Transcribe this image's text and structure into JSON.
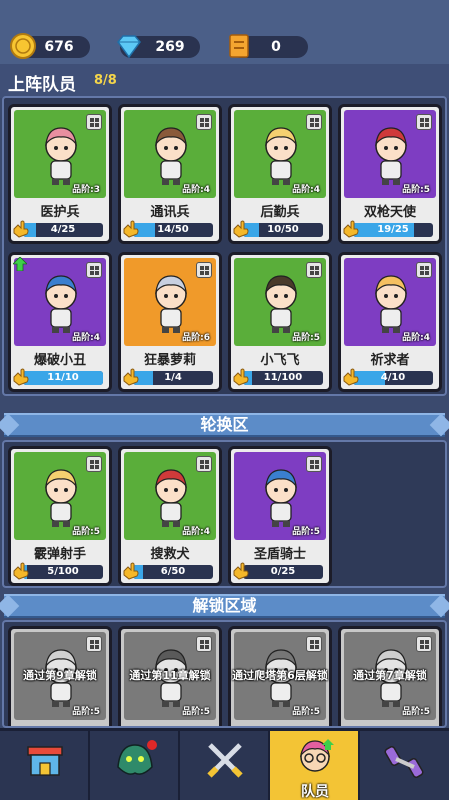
{
  "resources": {
    "coins": "676",
    "gems": "269",
    "tickets": "0"
  },
  "lineup": {
    "title": "上阵队员",
    "count": "8/8",
    "heroes": [
      {
        "name": "医护兵",
        "rank": "品阶:3",
        "progress": "4/25",
        "fill": 0.16,
        "bg": "green"
      },
      {
        "name": "通讯兵",
        "rank": "品阶:4",
        "progress": "14/50",
        "fill": 0.28,
        "bg": "green"
      },
      {
        "name": "后勤兵",
        "rank": "品阶:4",
        "progress": "10/50",
        "fill": 0.2,
        "bg": "green"
      },
      {
        "name": "双枪天使",
        "rank": "品阶:5",
        "progress": "19/25",
        "fill": 0.76,
        "bg": "purple"
      },
      {
        "name": "爆破小丑",
        "rank": "品阶:4",
        "progress": "11/10",
        "fill": 1.0,
        "bg": "purple"
      },
      {
        "name": "狂暴萝莉",
        "rank": "品阶:6",
        "progress": "1/4",
        "fill": 0.25,
        "bg": "orange"
      },
      {
        "name": "小飞飞",
        "rank": "品阶:5",
        "progress": "11/100",
        "fill": 0.11,
        "bg": "green"
      },
      {
        "name": "祈求者",
        "rank": "品阶:4",
        "progress": "4/10",
        "fill": 0.4,
        "bg": "purple"
      }
    ]
  },
  "rotation": {
    "title": "轮换区",
    "heroes": [
      {
        "name": "霰弹射手",
        "rank": "品阶:5",
        "progress": "5/100",
        "fill": 0.05,
        "bg": "green"
      },
      {
        "name": "搜救犬",
        "rank": "品阶:4",
        "progress": "6/50",
        "fill": 0.12,
        "bg": "green"
      },
      {
        "name": "圣盾骑士",
        "rank": "品阶:5",
        "progress": "0/25",
        "fill": 0.0,
        "bg": "purple"
      }
    ]
  },
  "unlock": {
    "title": "解锁区域",
    "heroes": [
      {
        "condition": "通过第9章解锁",
        "rank": "品阶:5"
      },
      {
        "condition": "通过第11章解锁",
        "rank": "品阶:5"
      },
      {
        "condition": "通过爬塔第6层解锁",
        "rank": "品阶:5"
      },
      {
        "condition": "通过第7章解锁",
        "rank": "品阶:5"
      }
    ]
  },
  "nav": {
    "items": [
      {
        "icon": "shop-icon",
        "label": ""
      },
      {
        "icon": "monster-icon",
        "label": ""
      },
      {
        "icon": "crossed-swords-icon",
        "label": ""
      },
      {
        "icon": "team-member-icon",
        "label": "队员"
      },
      {
        "icon": "dumbbell-icon",
        "label": ""
      }
    ],
    "active_index": 3
  },
  "colors": {
    "green": "#5aae3a",
    "purple": "#7e3dc2",
    "orange": "#f09a2a",
    "accent": "#f3c435"
  }
}
